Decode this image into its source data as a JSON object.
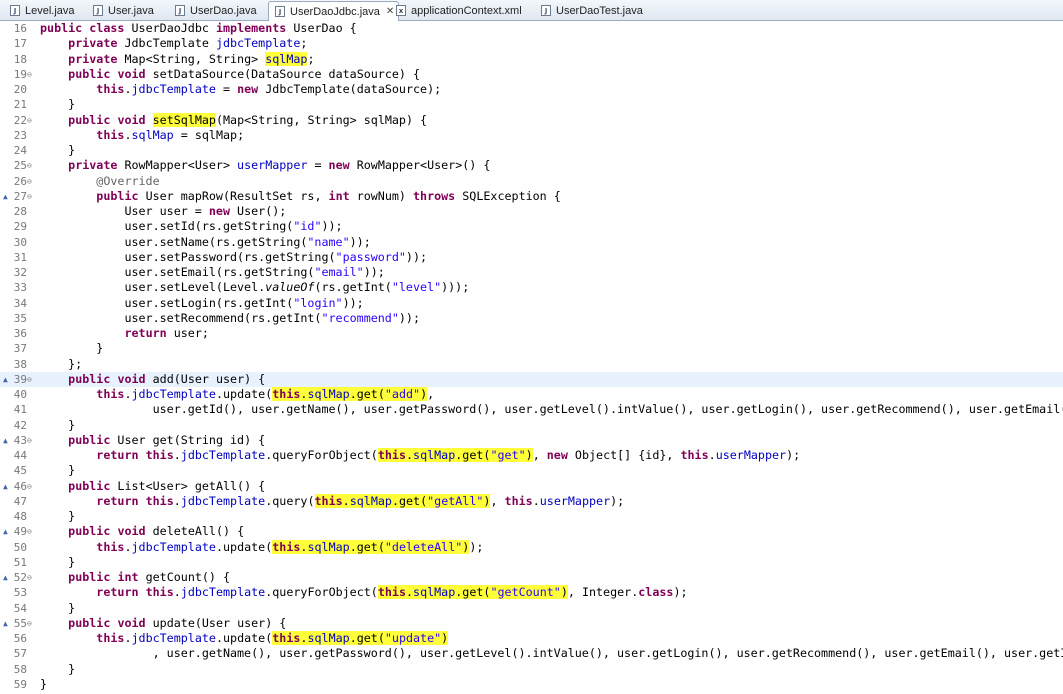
{
  "tabs": [
    {
      "label": "Level.java",
      "icon": "J",
      "active": false
    },
    {
      "label": "User.java",
      "icon": "J",
      "active": false
    },
    {
      "label": "UserDao.java",
      "icon": "J",
      "active": false
    },
    {
      "label": "UserDaoJdbc.java",
      "icon": "J",
      "active": true,
      "close": "✕"
    },
    {
      "label": "applicationContext.xml",
      "icon": "x",
      "active": false
    },
    {
      "label": "UserDaoTest.java",
      "icon": "J",
      "active": false
    }
  ],
  "colors": {
    "keyword": "#7f0055",
    "field": "#0000c0",
    "string": "#2a00ff",
    "annotation": "#646464",
    "highlight": "#ffff3a",
    "current_line": "#e8f2fe"
  },
  "editor": {
    "lines": [
      {
        "num": "16",
        "text": "public class UserDaoJdbc implements UserDao {"
      },
      {
        "num": "17",
        "text": "private JdbcTemplate jdbcTemplate;"
      },
      {
        "num": "18",
        "text": "private Map<String, String> sqlMap;"
      },
      {
        "num": "19",
        "text": "public void setDataSource(DataSource dataSource) {"
      },
      {
        "num": "20",
        "text": "this.jdbcTemplate = new JdbcTemplate(dataSource);"
      },
      {
        "num": "21",
        "text": "}"
      },
      {
        "num": "22",
        "text": "public void setSqlMap(Map<String, String> sqlMap) {"
      },
      {
        "num": "23",
        "text": "this.sqlMap = sqlMap;"
      },
      {
        "num": "24",
        "text": "}"
      },
      {
        "num": "25",
        "text": "private RowMapper<User> userMapper = new RowMapper<User>() {"
      },
      {
        "num": "26",
        "text": "@Override"
      },
      {
        "num": "27",
        "text": "public User mapRow(ResultSet rs, int rowNum) throws SQLException {"
      },
      {
        "num": "28",
        "text": "User user = new User();"
      },
      {
        "num": "29",
        "text": "user.setId(rs.getString(\"id\"));"
      },
      {
        "num": "30",
        "text": "user.setName(rs.getString(\"name\"));"
      },
      {
        "num": "31",
        "text": "user.setPassword(rs.getString(\"password\"));"
      },
      {
        "num": "32",
        "text": "user.setEmail(rs.getString(\"email\"));"
      },
      {
        "num": "33",
        "text": "user.setLevel(Level.valueOf(rs.getInt(\"level\")));"
      },
      {
        "num": "34",
        "text": "user.setLogin(rs.getInt(\"login\"));"
      },
      {
        "num": "35",
        "text": "user.setRecommend(rs.getInt(\"recommend\"));"
      },
      {
        "num": "36",
        "text": "return user;"
      },
      {
        "num": "37",
        "text": "}"
      },
      {
        "num": "38",
        "text": "};"
      },
      {
        "num": "39",
        "text": "public void add(User user) {"
      },
      {
        "num": "40",
        "text": "this.jdbcTemplate.update(this.sqlMap.get(\"add\"),"
      },
      {
        "num": "41",
        "text": "user.getId(), user.getName(), user.getPassword(), user.getLevel().intValue(), user.getLogin(), user.getRecommend(), user.getEmail());"
      },
      {
        "num": "42",
        "text": "}"
      },
      {
        "num": "43",
        "text": "public User get(String id) {"
      },
      {
        "num": "44",
        "text": "return this.jdbcTemplate.queryForObject(this.sqlMap.get(\"get\"), new Object[] {id}, this.userMapper);"
      },
      {
        "num": "45",
        "text": "}"
      },
      {
        "num": "46",
        "text": "public List<User> getAll() {"
      },
      {
        "num": "47",
        "text": "return this.jdbcTemplate.query(this.sqlMap.get(\"getAll\"), this.userMapper);"
      },
      {
        "num": "48",
        "text": "}"
      },
      {
        "num": "49",
        "text": "public void deleteAll() {"
      },
      {
        "num": "50",
        "text": "this.jdbcTemplate.update(this.sqlMap.get(\"deleteAll\"));"
      },
      {
        "num": "51",
        "text": "}"
      },
      {
        "num": "52",
        "text": "public int getCount() {"
      },
      {
        "num": "53",
        "text": "return this.jdbcTemplate.queryForObject(this.sqlMap.get(\"getCount\"), Integer.class);"
      },
      {
        "num": "54",
        "text": "}"
      },
      {
        "num": "55",
        "text": "public void update(User user) {"
      },
      {
        "num": "56",
        "text": "this.jdbcTemplate.update(this.sqlMap.get(\"update\")"
      },
      {
        "num": "57",
        "text": ", user.getName(), user.getPassword(), user.getLevel().intValue(), user.getLogin(), user.getRecommend(), user.getEmail(), user.getId());"
      },
      {
        "num": "58",
        "text": "}"
      },
      {
        "num": "59",
        "text": "}"
      }
    ]
  }
}
